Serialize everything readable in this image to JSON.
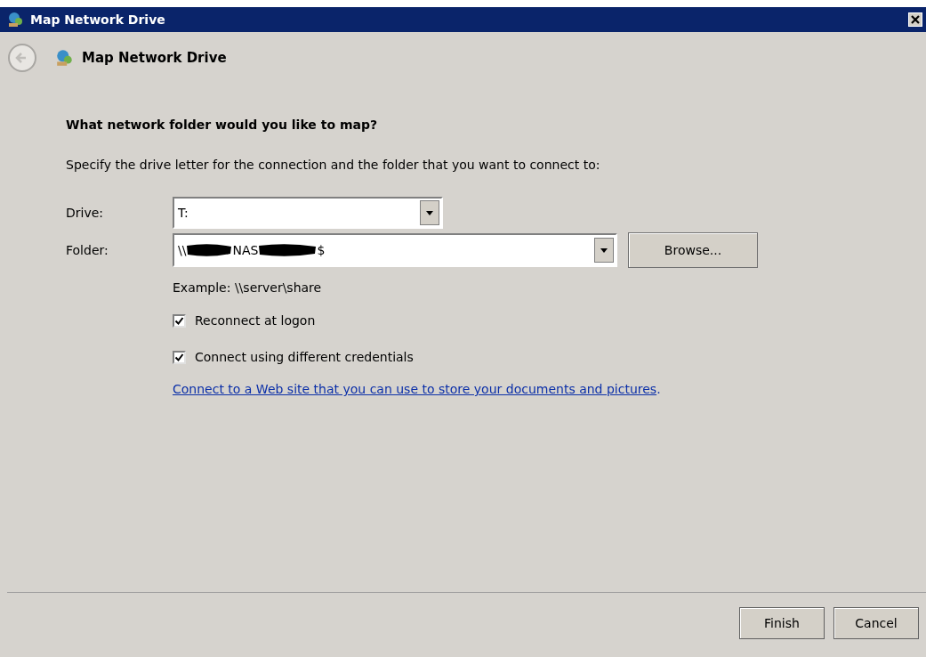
{
  "window": {
    "title": "Map Network Drive"
  },
  "header": {
    "title": "Map Network Drive"
  },
  "heading": "What network folder would you like to map?",
  "instruction": "Specify the drive letter for the connection and the folder that you want to connect to:",
  "drive": {
    "label": "Drive:",
    "value": "T:"
  },
  "folder": {
    "label": "Folder:",
    "value_parts": [
      "\\\\",
      "NAS",
      "$"
    ],
    "browse_button": "Browse..."
  },
  "example": "Example: \\\\server\\share",
  "options": [
    {
      "label": "Reconnect at logon",
      "checked": true
    },
    {
      "label": "Connect using different credentials",
      "checked": true
    }
  ],
  "link": "Connect to a Web site that you can use to store your documents and pictures",
  "link_suffix": ".",
  "buttons": [
    "Finish",
    "Cancel"
  ]
}
